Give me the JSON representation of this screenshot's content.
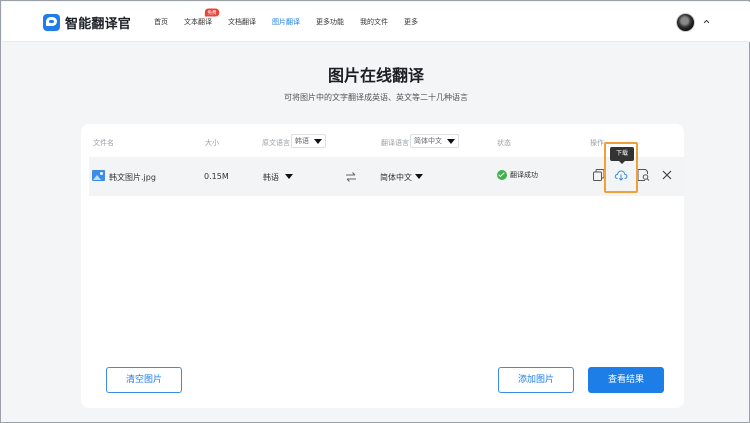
{
  "app": {
    "name": "智能翻译官"
  },
  "nav": {
    "items": [
      {
        "label": "首页"
      },
      {
        "label": "文本翻译",
        "badge": "免费"
      },
      {
        "label": "文档翻译"
      },
      {
        "label": "图片翻译",
        "active": true
      },
      {
        "label": "更多功能"
      },
      {
        "label": "我的文件"
      },
      {
        "label": "更多"
      }
    ]
  },
  "page": {
    "title": "图片在线翻译",
    "subtitle": "可将图片中的文字翻译成英语、英文等二十几种语言"
  },
  "table": {
    "headers": {
      "filename": "文件名",
      "size": "大小",
      "source_lang": "原文语言",
      "source_lang_value": "韩语",
      "target_lang": "翻译语言",
      "target_lang_value": "简体中文",
      "status": "状态",
      "actions": "操作"
    },
    "rows": [
      {
        "filename": "韩文图片.jpg",
        "size": "0.15M",
        "source_lang": "韩语",
        "target_lang": "简体中文",
        "status": "翻译成功"
      }
    ]
  },
  "tooltip": {
    "download": "下载"
  },
  "buttons": {
    "clear": "清空图片",
    "add": "添加图片",
    "view": "查看结果"
  },
  "colors": {
    "accent": "#1e7ee8",
    "success": "#3bb54a",
    "highlight": "#f0a03a",
    "badge": "#e8443a"
  }
}
